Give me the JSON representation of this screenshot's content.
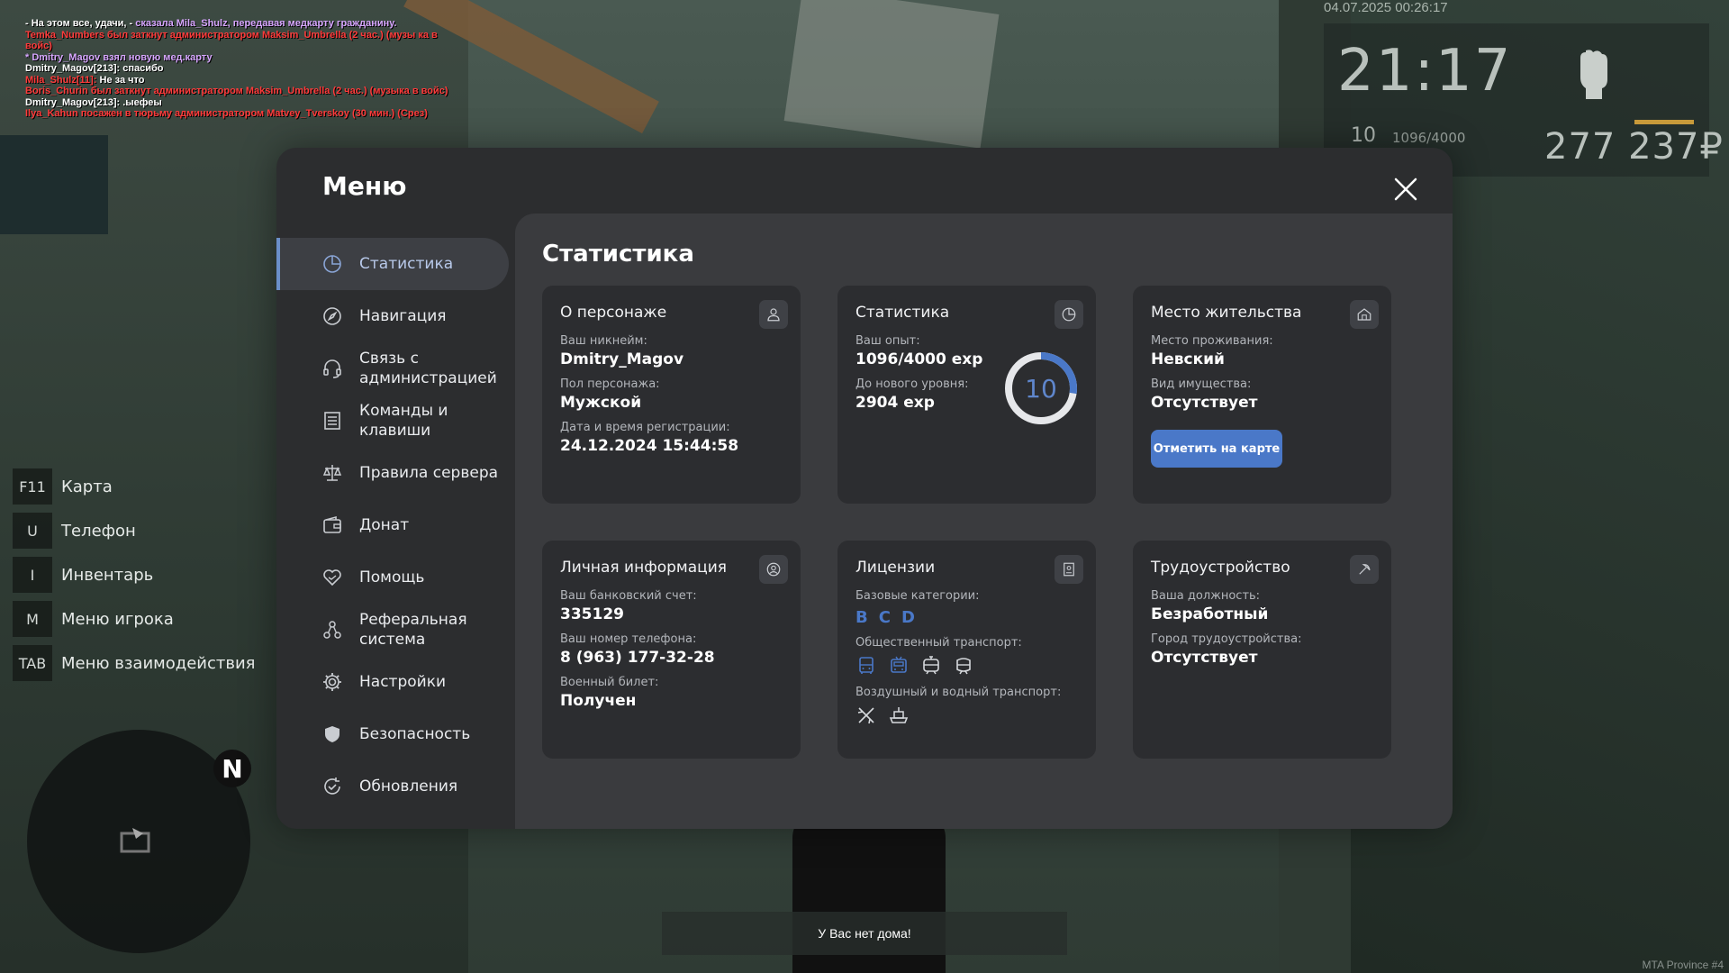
{
  "chat": [
    {
      "color": "white",
      "text": "- На этом все, удачи, - "
    },
    {
      "color": "purple",
      "text": "сказала Mila_Shulz, передавая медкарту гражданину."
    },
    {
      "color": "red",
      "text": "Temka_Numbers был заткнут администратором Maksim_Umbrella (2 час.) (музы ка в войс)"
    },
    {
      "color": "purple",
      "text": "* Dmitry_Magov взял новую мед.карту"
    },
    {
      "color": "white",
      "text": "Dmitry_Magov[213]: спасибо"
    },
    {
      "color": "red",
      "text": "Mila_Shulz[11]: "
    },
    {
      "color": "white",
      "text": "Не за что"
    },
    {
      "color": "red",
      "text": "Boris_Churin был заткнут администратором Maksim_Umbrella (2 час.) (музыка в войс)"
    },
    {
      "color": "white",
      "text": "Dmitry_Magov[213]: .ыефеы"
    },
    {
      "color": "red",
      "text": "Ilya_Kahun посажен в тюрьму администратором Matvey_Tverskoy (30 мин.) (Срез)"
    }
  ],
  "hud": {
    "datetime": "04.07.2025 00:26:17",
    "time": "21:17",
    "level": "10",
    "exp": "1096/4000",
    "money": "277 237₽"
  },
  "keys": [
    {
      "key": "F11",
      "label": "Карта"
    },
    {
      "key": "U",
      "label": "Телефон"
    },
    {
      "key": "I",
      "label": "Инвентарь"
    },
    {
      "key": "M",
      "label": "Меню игрока"
    },
    {
      "key": "TAB",
      "label": "Меню взаимодействия"
    }
  ],
  "minimap": {
    "north": "N"
  },
  "menu": {
    "title": "Меню",
    "nav": [
      {
        "label": "Статистика",
        "icon": "pie-chart-icon",
        "active": true
      },
      {
        "label": "Навигация",
        "icon": "compass-icon"
      },
      {
        "label": "Связь с администрацией",
        "icon": "headset-icon"
      },
      {
        "label": "Команды и клавиши",
        "icon": "document-list-icon"
      },
      {
        "label": "Правила сервера",
        "icon": "scales-icon"
      },
      {
        "label": "Донат",
        "icon": "wallet-icon"
      },
      {
        "label": "Помощь",
        "icon": "heart-hand-icon"
      },
      {
        "label": "Реферальная система",
        "icon": "referral-icon"
      },
      {
        "label": "Настройки",
        "icon": "gear-icon"
      },
      {
        "label": "Безопасность",
        "icon": "shield-icon"
      },
      {
        "label": "Обновления",
        "icon": "refresh-check-icon"
      }
    ],
    "content_title": "Статистика",
    "character": {
      "title": "О персонаже",
      "nickname_label": "Ваш никнейм:",
      "nickname": "Dmitry_Magov",
      "gender_label": "Пол персонажа:",
      "gender": "Мужской",
      "reg_label": "Дата и время регистрации:",
      "reg": "24.12.2024 15:44:58"
    },
    "stats": {
      "title": "Статистика",
      "exp_label": "Ваш опыт:",
      "exp": "1096/4000 exp",
      "next_label": "До нового уровня:",
      "next": "2904 exp",
      "level": "10",
      "progress": 0.274
    },
    "residence": {
      "title": "Место жительства",
      "place_label": "Место проживания:",
      "place": "Невский",
      "property_label": "Вид имущества:",
      "property": "Отсутствует",
      "button": "Отметить на карте"
    },
    "personal": {
      "title": "Личная информация",
      "bank_label": "Ваш банковский счет:",
      "bank": "335129",
      "phone_label": "Ваш номер телефона:",
      "phone": "8 (963) 177-32-28",
      "military_label": "Военный билет:",
      "military": "Получен"
    },
    "licenses": {
      "title": "Лицензии",
      "base_label": "Базовые категории:",
      "categories": [
        "B",
        "C",
        "D"
      ],
      "public_label": "Общественный транспорт:",
      "air_label": "Воздушный и водный транспорт:"
    },
    "employment": {
      "title": "Трудоустройство",
      "position_label": "Ваша должность:",
      "position": "Безработный",
      "city_label": "Город трудоустройства:",
      "city": "Отсутствует"
    }
  },
  "notice": "У Вас нет дома!",
  "server": "MTA Province #4",
  "colors": {
    "accent": "#4a78c8",
    "panel": "#2c2d2f",
    "content": "#3a3b3e"
  }
}
